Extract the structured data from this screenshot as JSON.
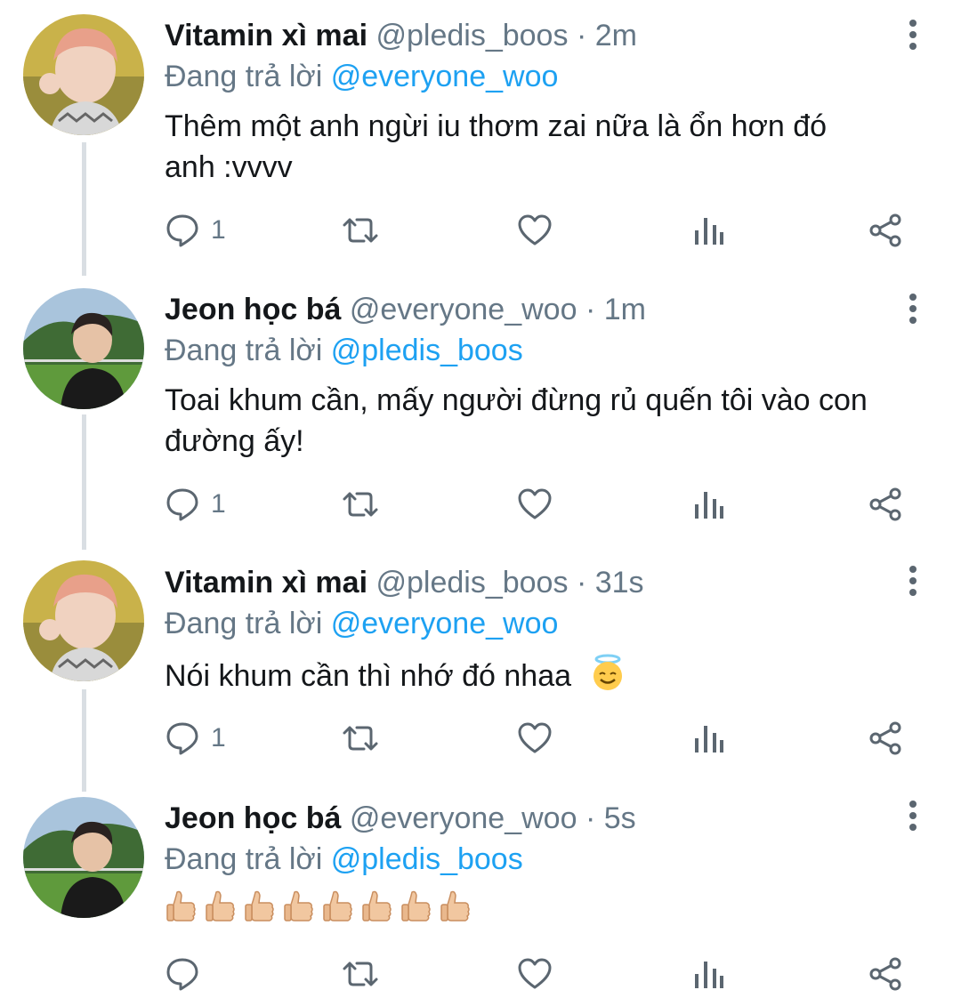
{
  "reply_prefix": "Đang trả lời",
  "tweets": [
    {
      "display_name": "Vitamin xì mai",
      "handle": "@pledis_boos",
      "time": "· 2m",
      "reply_to": "@everyone_woo",
      "text": "Thêm một anh ngừi iu thơm zai nữa là ổn hơn đó anh :vvvv",
      "reply_count": "1",
      "avatar": "pink-hair-avatar"
    },
    {
      "display_name": "Jeon học bá",
      "handle": "@everyone_woo",
      "time": "· 1m",
      "reply_to": "@pledis_boos",
      "text": "Toai khum cần, mấy người đừng rủ quến tôi vào con đường ấy!",
      "reply_count": "1",
      "avatar": "outdoor-dark-hair-avatar"
    },
    {
      "display_name": "Vitamin xì mai",
      "handle": "@pledis_boos",
      "time": "· 31s",
      "reply_to": "@everyone_woo",
      "text": "Nói khum cần thì nhớ đó nhaa",
      "emoji": "halo-smile-emoji",
      "reply_count": "1",
      "avatar": "pink-hair-avatar"
    },
    {
      "display_name": "Jeon học bá",
      "handle": "@everyone_woo",
      "time": "· 5s",
      "reply_to": "@pledis_boos",
      "emoji_row": "thumbs-up-emoji x8",
      "reply_count": "",
      "avatar": "outdoor-dark-hair-avatar"
    }
  ],
  "colors": {
    "mention": "#1da1f2",
    "meta": "#657786",
    "icon": "#5b6670",
    "thread_line": "#d9dee3"
  }
}
